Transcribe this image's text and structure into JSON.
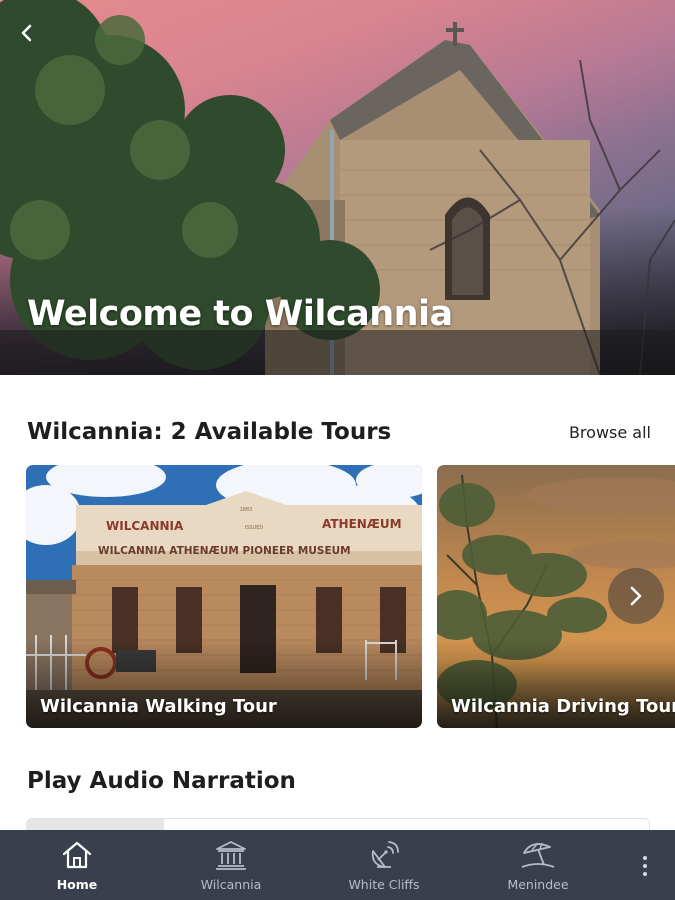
{
  "hero": {
    "title": "Welcome to Wilcannia",
    "back_icon": "chevron-left-icon"
  },
  "tours": {
    "heading": "Wilcannia: 2 Available Tours",
    "browse_all_label": "Browse all",
    "items": [
      {
        "label": "Wilcannia Walking Tour",
        "sign_top_left": "WILCANNIA",
        "sign_top_right": "ATHENÆUM",
        "sign_small": "1883",
        "sign_small_sub": "ISSUED",
        "sign_main": "WILCANNIA ATHENÆUM PIONEER MUSEUM"
      },
      {
        "label": "Wilcannia Driving Tour"
      }
    ],
    "next_icon": "chevron-right-icon"
  },
  "audio": {
    "heading": "Play Audio Narration",
    "progress_fraction": 0.22
  },
  "nav": {
    "items": [
      {
        "label": "Home",
        "icon": "home-icon",
        "active": true
      },
      {
        "label": "Wilcannia",
        "icon": "building-icon",
        "active": false
      },
      {
        "label": "White Cliffs",
        "icon": "satellite-dish-icon",
        "active": false
      },
      {
        "label": "Menindee",
        "icon": "beach-umbrella-icon",
        "active": false
      }
    ],
    "more_icon": "more-vertical-icon"
  },
  "colors": {
    "nav_background": "#3a3f4e",
    "nav_active": "#ffffff",
    "nav_inactive": "#b9bcc6",
    "heading_text": "#1e1e1e"
  }
}
